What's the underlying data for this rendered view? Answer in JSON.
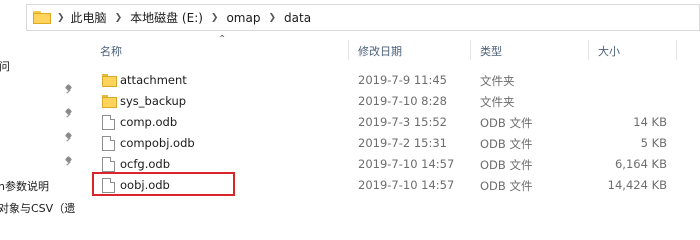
{
  "address_bar": {
    "crumbs": [
      "此电脑",
      "本地磁盘 (E:)",
      "omap",
      "data"
    ]
  },
  "nav_pane": {
    "items": [
      {
        "label": "i问"
      },
      {
        "label": "h参数说明"
      },
      {
        "label": "对象与CSV（遗"
      }
    ]
  },
  "columns": {
    "name": "名称",
    "modified": "修改日期",
    "type": "类型",
    "size": "大小"
  },
  "files": [
    {
      "name": "attachment",
      "modified": "2019-7-9 11:45",
      "type": "文件夹",
      "size": "",
      "icon": "folder-icon"
    },
    {
      "name": "sys_backup",
      "modified": "2019-7-10 8:28",
      "type": "文件夹",
      "size": "",
      "icon": "folder-icon"
    },
    {
      "name": "comp.odb",
      "modified": "2019-7-3 15:52",
      "type": "ODB 文件",
      "size": "14 KB",
      "icon": "file-icon"
    },
    {
      "name": "compobj.odb",
      "modified": "2019-7-2 15:31",
      "type": "ODB 文件",
      "size": "5 KB",
      "icon": "file-icon"
    },
    {
      "name": "ocfg.odb",
      "modified": "2019-7-10 14:57",
      "type": "ODB 文件",
      "size": "6,164 KB",
      "icon": "file-icon"
    },
    {
      "name": "oobj.odb",
      "modified": "2019-7-10 14:57",
      "type": "ODB 文件",
      "size": "14,424 KB",
      "icon": "file-icon",
      "highlighted": true
    }
  ],
  "colors": {
    "header_text": "#4c607a",
    "highlight_border": "#d9262b",
    "folder": "#ffd35c"
  }
}
